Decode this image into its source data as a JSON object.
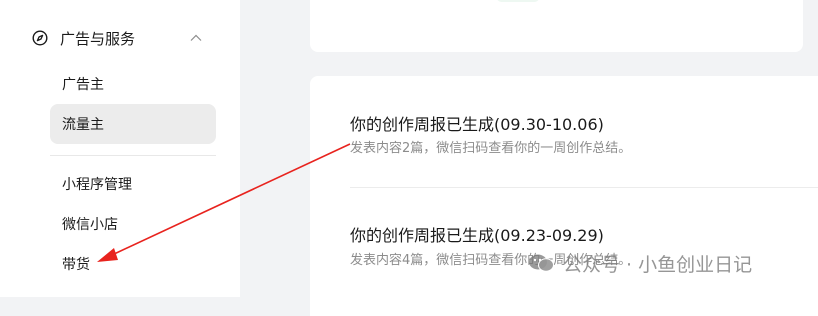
{
  "sidebar": {
    "section_title": "广告与服务",
    "items": [
      {
        "label": "广告主"
      },
      {
        "label": "流量主"
      },
      {
        "label": "小程序管理"
      },
      {
        "label": "微信小店"
      },
      {
        "label": "带货"
      }
    ]
  },
  "reports": [
    {
      "title": "你的创作周报已生成(09.30-10.06)",
      "desc": "发表内容2篇，微信扫码查看你的一周创作总结。"
    },
    {
      "title": "你的创作周报已生成(09.23-09.29)",
      "desc": "发表内容4篇，微信扫码查看你的一周创作总结。"
    }
  ],
  "watermark": {
    "text": "公众号 · 小鱼创业日记"
  },
  "colors": {
    "active_bg": "#ececec",
    "annotation_arrow": "#e8231e",
    "accent_pill": "#eef8f2"
  },
  "icons": [
    "compass-icon",
    "chevron-up-icon",
    "wechat-logo-icon"
  ]
}
